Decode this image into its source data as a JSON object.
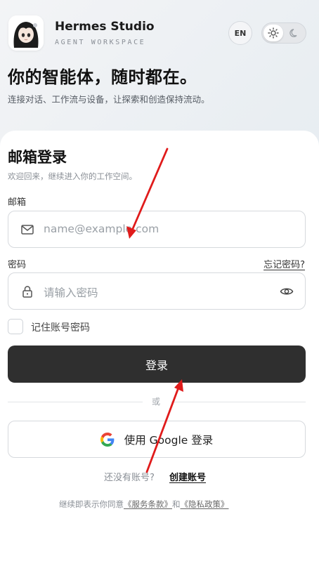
{
  "brand": {
    "title": "Hermes Studio",
    "subtitle": "AGENT WORKSPACE",
    "avatar": "anime-girl-avatar"
  },
  "header_controls": {
    "language_label": "EN",
    "theme_options": [
      "sun-icon",
      "moon-icon"
    ],
    "theme_selected": "light"
  },
  "hero": {
    "title": "你的智能体，随时都在。",
    "subtitle": "连接对话、工作流与设备，让探索和创造保持流动。"
  },
  "login_card": {
    "title": "邮箱登录",
    "subtitle": "欢迎回来，继续进入你的工作空间。",
    "email_label": "邮箱",
    "email_placeholder": "name@example.com",
    "password_label": "密码",
    "forgot_label": "忘记密码?",
    "password_placeholder": "请输入密码",
    "remember_label": "记住账号密码",
    "remember_checked": false,
    "login_label": "登录",
    "divider_text": "或",
    "google_label": "使用 Google 登录",
    "no_account_text": "还没有账号?",
    "create_account_label": "创建账号",
    "terms_prefix": "继续即表示你同意",
    "terms_link": "《服务条款》",
    "terms_and": "和",
    "privacy_link": "《隐私政策》"
  },
  "colors": {
    "primary_button": "#2f2f2f",
    "annotation_arrow": "#e01b1b"
  }
}
